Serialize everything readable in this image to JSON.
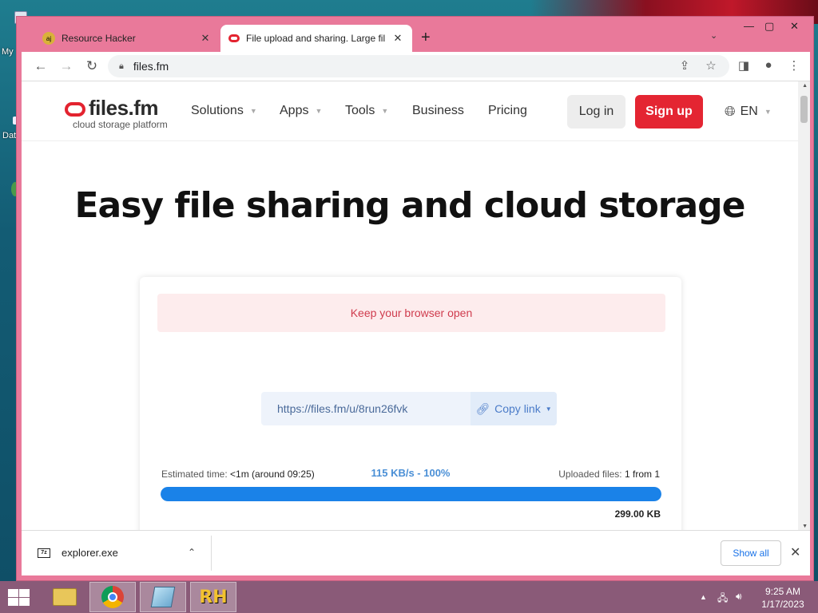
{
  "desktop": {
    "labels": [
      "My",
      "Dat"
    ]
  },
  "browser": {
    "tabs": [
      {
        "title": "Resource Hacker",
        "favicon": "resource-hacker-icon"
      },
      {
        "title": "File upload and sharing. Large fil",
        "favicon": "filesfm-icon"
      }
    ],
    "address": "files.fm"
  },
  "site": {
    "logo_main": "files.fm",
    "logo_sub": "cloud storage platform",
    "menu": [
      "Solutions",
      "Apps",
      "Tools",
      "Business",
      "Pricing"
    ],
    "login": "Log in",
    "signup": "Sign up",
    "language": "EN",
    "hero": "Easy file sharing and cloud storage"
  },
  "upload": {
    "notice": "Keep your browser open",
    "link": "https://files.fm/u/8run26fvk",
    "copy_label": "Copy link",
    "estimated_label": "Estimated time:",
    "estimated_value": "<1m (around 09:25)",
    "speed": "115 KB/s - 100%",
    "uploaded_label": "Uploaded files:",
    "uploaded_value": "1 from 1",
    "progress": 1.0,
    "size": "299.00 KB"
  },
  "downloads": {
    "file": "explorer.exe",
    "show_all": "Show all"
  },
  "taskbar": {
    "time": "9:25 AM",
    "date": "1/17/2023",
    "apps": [
      "file-explorer-icon",
      "chrome-icon",
      "notepad-icon",
      "resource-hacker-icon"
    ]
  },
  "colors": {
    "window_frame": "#e9799a",
    "signup": "#e42532",
    "progress": "#1a82e8",
    "notice_text": "#cf3c4e"
  }
}
